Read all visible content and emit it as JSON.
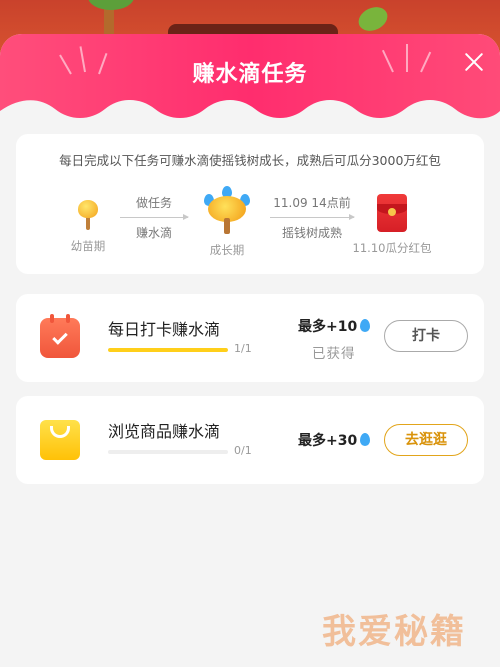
{
  "modal": {
    "title": "赚水滴任务",
    "description": "每日完成以下任务可赚水滴使摇钱树成长，成熟后可瓜分3000万红包"
  },
  "progress": {
    "stage1_label": "幼苗期",
    "step1_top": "做任务",
    "step1_bottom": "赚水滴",
    "stage2_label": "成长期",
    "step2_top": "11.09 14点前",
    "step2_bottom": "摇钱树成熟",
    "stage3_label": "11.10瓜分红包"
  },
  "tasks": [
    {
      "name": "每日打卡赚水滴",
      "progress_text": "1/1",
      "progress_fraction": 1.0,
      "reward": "最多+10",
      "status": "已获得",
      "button": "打卡"
    },
    {
      "name": "浏览商品赚水滴",
      "progress_text": "0/1",
      "progress_fraction": 0.0,
      "reward": "最多+30",
      "button": "去逛逛"
    }
  ],
  "watermark": "我爱秘籍",
  "colors": {
    "header_pink": "#ff2d6e",
    "progress_yellow": "#ffcf1a",
    "water_blue": "#3fa9f5",
    "browse_gold": "#d9930b"
  },
  "icons": [
    "close-icon",
    "sapling-icon",
    "money-tree-icon",
    "red-envelope-icon",
    "calendar-check-icon",
    "shopping-bag-icon",
    "water-drop-icon"
  ]
}
